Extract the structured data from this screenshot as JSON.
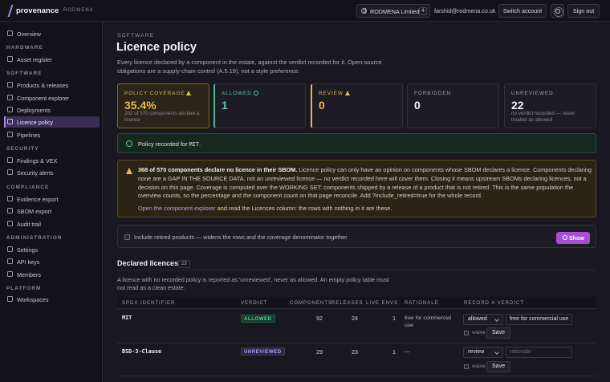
{
  "topbar": {
    "brand": "provenance",
    "org_tag": "RODMENA",
    "org_name": "RODMENA Limited",
    "org_count": "4",
    "email": "farshid@rodmena.co.uk",
    "switch_label": "Switch account",
    "signout_label": "Sign out"
  },
  "sidebar": {
    "overview": "Overview",
    "hardware": "HARDWARE",
    "asset_register": "Asset register",
    "software": "SOFTWARE",
    "products": "Products & releases",
    "explorer": "Component explorer",
    "deployments": "Deployments",
    "licence_policy": "Licence policy",
    "pipelines": "Pipelines",
    "security": "SECURITY",
    "findings": "Findings & VEX",
    "alerts": "Security alerts",
    "compliance": "COMPLIANCE",
    "evidence": "Evidence export",
    "sbom": "SBOM export",
    "audit": "Audit trail",
    "administration": "ADMINISTRATION",
    "settings": "Settings",
    "api_keys": "API keys",
    "members": "Members",
    "platform": "PLATFORM",
    "workspaces": "Workspaces"
  },
  "page": {
    "eyebrow": "SOFTWARE",
    "title": "Licence policy",
    "intro": "Every licence declared by a component in the estate, against the verdict recorded for it. Open-source obligations are a supply-chain control (A.5.19), not a style preference."
  },
  "stats": {
    "coverage_label": "POLICY COVERAGE",
    "coverage_value": "35.4%",
    "coverage_desc": "202 of 570 components declare a licence",
    "allowed_label": "ALLOWED",
    "allowed_value": "1",
    "review_label": "REVIEW",
    "review_value": "0",
    "forbidden_label": "FORBIDDEN",
    "forbidden_value": "0",
    "unreviewed_label": "UNREVIEWED",
    "unreviewed_value": "22",
    "unreviewed_desc": "no verdict recorded — never treated as allowed"
  },
  "banner_ok": {
    "text": "Policy recorded for ",
    "code": "MIT",
    "suffix": "."
  },
  "banner_warn": {
    "bold": "368 of 570 components declare no licence in their SBOM.",
    "text": " Licence policy can only have an opinion on components whose SBOM declares a licence. Components declaring none are a GAP IN THE SOURCE DATA, not an unreviewed licence — no verdict recorded here will cover them. Closing it means upstream SBOMs declaring licences, not a decision on this page. Coverage is computed over the WORKING SET: components shipped by a release of a product that is not retired. This is the same population the overview counts, so the percentage and the component count on that page reconcile. Add ?include_retired=true for the whole record.",
    "link": "Open the component explorer",
    "link_suffix": " and read the Licences column: the rows with nothing in it are these."
  },
  "retired": {
    "label": "Include retired products — widens the rows and the coverage denominator together",
    "show_label": "Show"
  },
  "declared": {
    "title": "Declared licences",
    "count": "23",
    "note": "A licence with no recorded policy is reported as 'unreviewed', never as allowed. An empty policy table must not read as a clean estate."
  },
  "table": {
    "headers": {
      "spdx": "SPDX IDENTIFIER",
      "verdict": "VERDICT",
      "components": "COMPONENTS",
      "releases": "RELEASES",
      "live_envs": "LIVE ENVS",
      "rationale": "RATIONALE",
      "record": "RECORD A VERDICT"
    },
    "rows": [
      {
        "spdx": "MIT",
        "verdict": "ALLOWED",
        "components": "92",
        "releases": "24",
        "live_envs": "1",
        "rationale": "free for commercial use",
        "select": "allowed",
        "input": "free for commercial use",
        "waive": "waive",
        "save": "Save"
      },
      {
        "spdx": "BSD-3-Clause",
        "verdict": "UNREVIEWED",
        "components": "29",
        "releases": "23",
        "live_envs": "1",
        "rationale": "—",
        "select": "review",
        "input_placeholder": "rationale",
        "waive": "waive",
        "save": "Save"
      }
    ]
  }
}
